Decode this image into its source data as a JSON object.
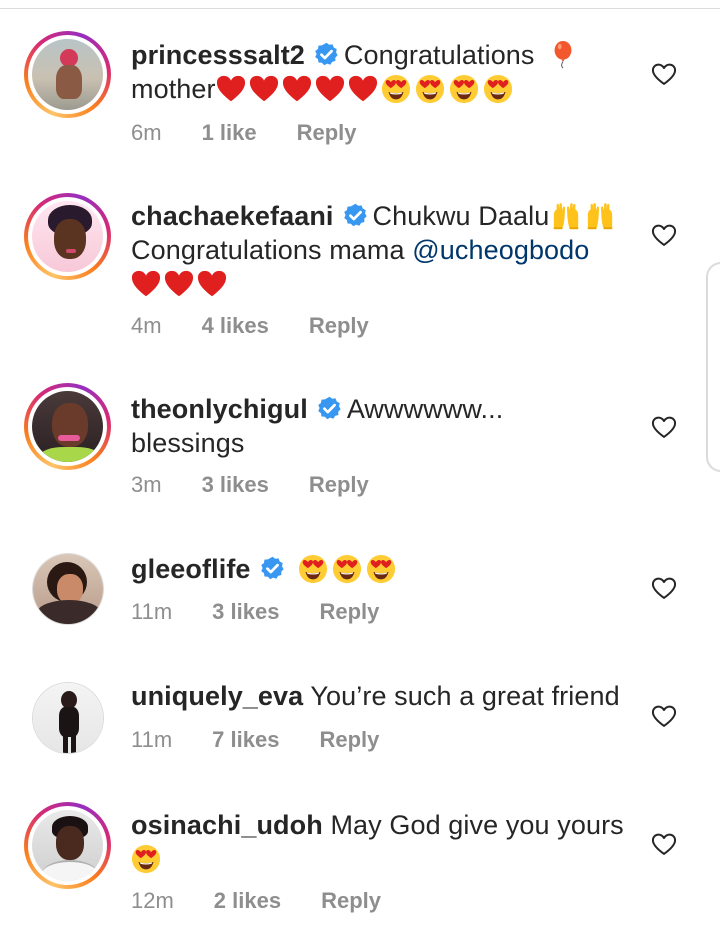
{
  "comments": [
    {
      "username": "princesssalt2",
      "verified": true,
      "text": "Congratulations",
      "text2": "mother",
      "time": "6m",
      "likes": "1 like",
      "reply": "Reply"
    },
    {
      "username": "chachaekefaani",
      "verified": true,
      "text": "Chukwu Daalu",
      "text2": "Congratulations mama ",
      "mention": "@ucheogbodo",
      "time": "4m",
      "likes": "4 likes",
      "reply": "Reply"
    },
    {
      "username": "theonlychigul",
      "verified": true,
      "text": "Awwwwww...",
      "text2": "blessings",
      "time": "3m",
      "likes": "3 likes",
      "reply": "Reply"
    },
    {
      "username": "gleeoflife",
      "verified": true,
      "time": "11m",
      "likes": "3 likes",
      "reply": "Reply"
    },
    {
      "username": "uniquely_eva",
      "verified": false,
      "text": "You’re such a great friend",
      "time": "11m",
      "likes": "7 likes",
      "reply": "Reply"
    },
    {
      "username": "osinachi_udoh",
      "verified": false,
      "text": "May God give you yours",
      "time": "12m",
      "likes": "2 likes",
      "reply": "Reply"
    }
  ],
  "colors": {
    "verified": "#3897f0",
    "heart_red": "#e0201f",
    "mention": "#00376b",
    "meta": "#8e8e8e"
  },
  "icons": [
    "verified-badge-icon",
    "balloon-icon",
    "red-heart-icon",
    "heart-eyes-icon",
    "raised-hands-icon",
    "like-heart-icon"
  ]
}
